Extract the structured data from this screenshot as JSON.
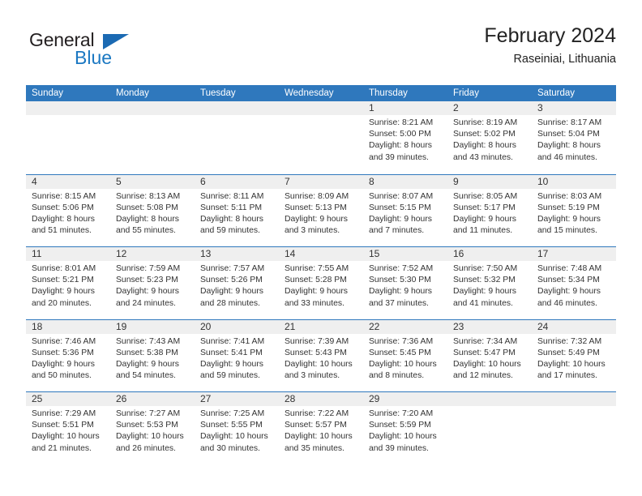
{
  "brand": {
    "name_top": "General",
    "name_bottom": "Blue",
    "logo_icon": "blue-triangle-icon",
    "colors": {
      "general_text": "#231f20",
      "blue_text": "#1b78c2",
      "triangle": "#1b6ab3"
    }
  },
  "header": {
    "title": "February 2024",
    "subtitle": "Raseiniai, Lithuania"
  },
  "theme": {
    "header_blue": "#2f78bd",
    "day_number_band": "#efefef",
    "text": "#333333"
  },
  "weekdays": [
    "Sunday",
    "Monday",
    "Tuesday",
    "Wednesday",
    "Thursday",
    "Friday",
    "Saturday"
  ],
  "weeks": [
    [
      {
        "day": "",
        "sunrise": "",
        "sunset": "",
        "daylight_line1": "",
        "daylight_line2": "",
        "empty": true
      },
      {
        "day": "",
        "sunrise": "",
        "sunset": "",
        "daylight_line1": "",
        "daylight_line2": "",
        "empty": true
      },
      {
        "day": "",
        "sunrise": "",
        "sunset": "",
        "daylight_line1": "",
        "daylight_line2": "",
        "empty": true
      },
      {
        "day": "",
        "sunrise": "",
        "sunset": "",
        "daylight_line1": "",
        "daylight_line2": "",
        "empty": true
      },
      {
        "day": "1",
        "sunrise": "Sunrise: 8:21 AM",
        "sunset": "Sunset: 5:00 PM",
        "daylight_line1": "Daylight: 8 hours",
        "daylight_line2": "and 39 minutes.",
        "empty": false
      },
      {
        "day": "2",
        "sunrise": "Sunrise: 8:19 AM",
        "sunset": "Sunset: 5:02 PM",
        "daylight_line1": "Daylight: 8 hours",
        "daylight_line2": "and 43 minutes.",
        "empty": false
      },
      {
        "day": "3",
        "sunrise": "Sunrise: 8:17 AM",
        "sunset": "Sunset: 5:04 PM",
        "daylight_line1": "Daylight: 8 hours",
        "daylight_line2": "and 46 minutes.",
        "empty": false
      }
    ],
    [
      {
        "day": "4",
        "sunrise": "Sunrise: 8:15 AM",
        "sunset": "Sunset: 5:06 PM",
        "daylight_line1": "Daylight: 8 hours",
        "daylight_line2": "and 51 minutes.",
        "empty": false
      },
      {
        "day": "5",
        "sunrise": "Sunrise: 8:13 AM",
        "sunset": "Sunset: 5:08 PM",
        "daylight_line1": "Daylight: 8 hours",
        "daylight_line2": "and 55 minutes.",
        "empty": false
      },
      {
        "day": "6",
        "sunrise": "Sunrise: 8:11 AM",
        "sunset": "Sunset: 5:11 PM",
        "daylight_line1": "Daylight: 8 hours",
        "daylight_line2": "and 59 minutes.",
        "empty": false
      },
      {
        "day": "7",
        "sunrise": "Sunrise: 8:09 AM",
        "sunset": "Sunset: 5:13 PM",
        "daylight_line1": "Daylight: 9 hours",
        "daylight_line2": "and 3 minutes.",
        "empty": false
      },
      {
        "day": "8",
        "sunrise": "Sunrise: 8:07 AM",
        "sunset": "Sunset: 5:15 PM",
        "daylight_line1": "Daylight: 9 hours",
        "daylight_line2": "and 7 minutes.",
        "empty": false
      },
      {
        "day": "9",
        "sunrise": "Sunrise: 8:05 AM",
        "sunset": "Sunset: 5:17 PM",
        "daylight_line1": "Daylight: 9 hours",
        "daylight_line2": "and 11 minutes.",
        "empty": false
      },
      {
        "day": "10",
        "sunrise": "Sunrise: 8:03 AM",
        "sunset": "Sunset: 5:19 PM",
        "daylight_line1": "Daylight: 9 hours",
        "daylight_line2": "and 15 minutes.",
        "empty": false
      }
    ],
    [
      {
        "day": "11",
        "sunrise": "Sunrise: 8:01 AM",
        "sunset": "Sunset: 5:21 PM",
        "daylight_line1": "Daylight: 9 hours",
        "daylight_line2": "and 20 minutes.",
        "empty": false
      },
      {
        "day": "12",
        "sunrise": "Sunrise: 7:59 AM",
        "sunset": "Sunset: 5:23 PM",
        "daylight_line1": "Daylight: 9 hours",
        "daylight_line2": "and 24 minutes.",
        "empty": false
      },
      {
        "day": "13",
        "sunrise": "Sunrise: 7:57 AM",
        "sunset": "Sunset: 5:26 PM",
        "daylight_line1": "Daylight: 9 hours",
        "daylight_line2": "and 28 minutes.",
        "empty": false
      },
      {
        "day": "14",
        "sunrise": "Sunrise: 7:55 AM",
        "sunset": "Sunset: 5:28 PM",
        "daylight_line1": "Daylight: 9 hours",
        "daylight_line2": "and 33 minutes.",
        "empty": false
      },
      {
        "day": "15",
        "sunrise": "Sunrise: 7:52 AM",
        "sunset": "Sunset: 5:30 PM",
        "daylight_line1": "Daylight: 9 hours",
        "daylight_line2": "and 37 minutes.",
        "empty": false
      },
      {
        "day": "16",
        "sunrise": "Sunrise: 7:50 AM",
        "sunset": "Sunset: 5:32 PM",
        "daylight_line1": "Daylight: 9 hours",
        "daylight_line2": "and 41 minutes.",
        "empty": false
      },
      {
        "day": "17",
        "sunrise": "Sunrise: 7:48 AM",
        "sunset": "Sunset: 5:34 PM",
        "daylight_line1": "Daylight: 9 hours",
        "daylight_line2": "and 46 minutes.",
        "empty": false
      }
    ],
    [
      {
        "day": "18",
        "sunrise": "Sunrise: 7:46 AM",
        "sunset": "Sunset: 5:36 PM",
        "daylight_line1": "Daylight: 9 hours",
        "daylight_line2": "and 50 minutes.",
        "empty": false
      },
      {
        "day": "19",
        "sunrise": "Sunrise: 7:43 AM",
        "sunset": "Sunset: 5:38 PM",
        "daylight_line1": "Daylight: 9 hours",
        "daylight_line2": "and 54 minutes.",
        "empty": false
      },
      {
        "day": "20",
        "sunrise": "Sunrise: 7:41 AM",
        "sunset": "Sunset: 5:41 PM",
        "daylight_line1": "Daylight: 9 hours",
        "daylight_line2": "and 59 minutes.",
        "empty": false
      },
      {
        "day": "21",
        "sunrise": "Sunrise: 7:39 AM",
        "sunset": "Sunset: 5:43 PM",
        "daylight_line1": "Daylight: 10 hours",
        "daylight_line2": "and 3 minutes.",
        "empty": false
      },
      {
        "day": "22",
        "sunrise": "Sunrise: 7:36 AM",
        "sunset": "Sunset: 5:45 PM",
        "daylight_line1": "Daylight: 10 hours",
        "daylight_line2": "and 8 minutes.",
        "empty": false
      },
      {
        "day": "23",
        "sunrise": "Sunrise: 7:34 AM",
        "sunset": "Sunset: 5:47 PM",
        "daylight_line1": "Daylight: 10 hours",
        "daylight_line2": "and 12 minutes.",
        "empty": false
      },
      {
        "day": "24",
        "sunrise": "Sunrise: 7:32 AM",
        "sunset": "Sunset: 5:49 PM",
        "daylight_line1": "Daylight: 10 hours",
        "daylight_line2": "and 17 minutes.",
        "empty": false
      }
    ],
    [
      {
        "day": "25",
        "sunrise": "Sunrise: 7:29 AM",
        "sunset": "Sunset: 5:51 PM",
        "daylight_line1": "Daylight: 10 hours",
        "daylight_line2": "and 21 minutes.",
        "empty": false
      },
      {
        "day": "26",
        "sunrise": "Sunrise: 7:27 AM",
        "sunset": "Sunset: 5:53 PM",
        "daylight_line1": "Daylight: 10 hours",
        "daylight_line2": "and 26 minutes.",
        "empty": false
      },
      {
        "day": "27",
        "sunrise": "Sunrise: 7:25 AM",
        "sunset": "Sunset: 5:55 PM",
        "daylight_line1": "Daylight: 10 hours",
        "daylight_line2": "and 30 minutes.",
        "empty": false
      },
      {
        "day": "28",
        "sunrise": "Sunrise: 7:22 AM",
        "sunset": "Sunset: 5:57 PM",
        "daylight_line1": "Daylight: 10 hours",
        "daylight_line2": "and 35 minutes.",
        "empty": false
      },
      {
        "day": "29",
        "sunrise": "Sunrise: 7:20 AM",
        "sunset": "Sunset: 5:59 PM",
        "daylight_line1": "Daylight: 10 hours",
        "daylight_line2": "and 39 minutes.",
        "empty": false
      },
      {
        "day": "",
        "sunrise": "",
        "sunset": "",
        "daylight_line1": "",
        "daylight_line2": "",
        "empty": true
      },
      {
        "day": "",
        "sunrise": "",
        "sunset": "",
        "daylight_line1": "",
        "daylight_line2": "",
        "empty": true
      }
    ]
  ]
}
